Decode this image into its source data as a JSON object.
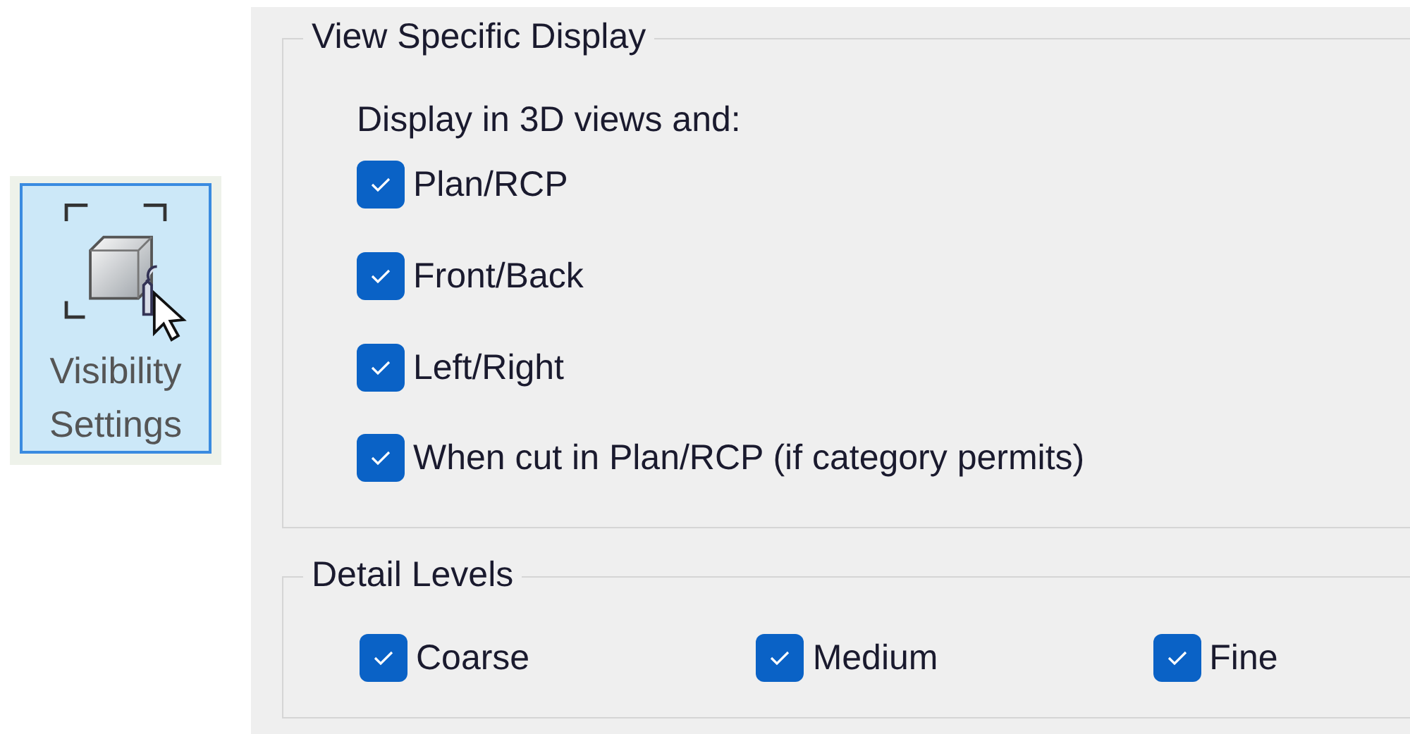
{
  "ribbon_button": {
    "label_lines": [
      "Visibility",
      "Settings"
    ],
    "selected": true
  },
  "view_specific_display": {
    "title": "View Specific Display",
    "caption": "Display in 3D views and:",
    "options": [
      {
        "label": "Plan/RCP",
        "checked": true
      },
      {
        "label": "Front/Back",
        "checked": true
      },
      {
        "label": "Left/Right",
        "checked": true
      },
      {
        "label": "When cut in Plan/RCP (if category permits)",
        "checked": true
      }
    ]
  },
  "detail_levels": {
    "title": "Detail Levels",
    "options": [
      {
        "label": "Coarse",
        "checked": true
      },
      {
        "label": "Medium",
        "checked": true
      },
      {
        "label": "Fine",
        "checked": true
      }
    ]
  }
}
